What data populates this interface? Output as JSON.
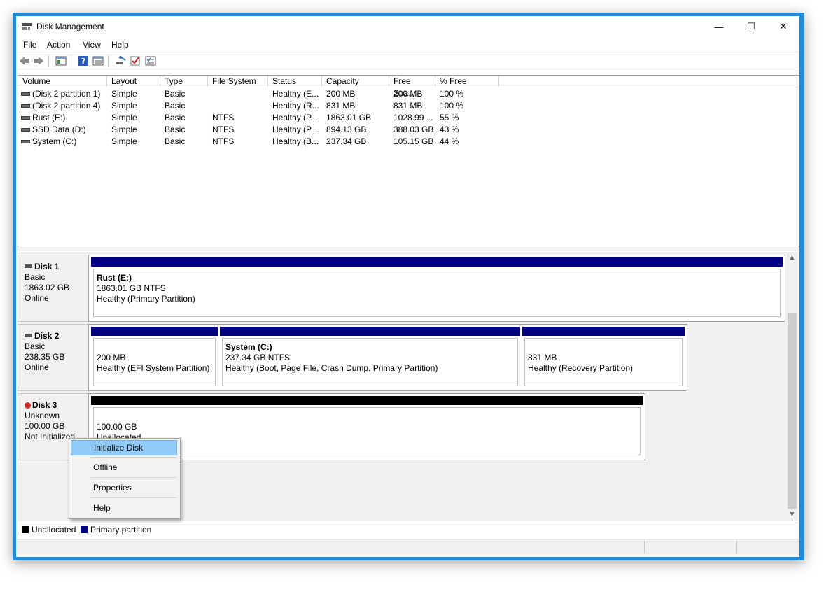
{
  "window": {
    "title": "Disk Management",
    "minimize": "—",
    "maximize": "☐",
    "close": "✕"
  },
  "menu": [
    "File",
    "Action",
    "View",
    "Help"
  ],
  "toolbar": {
    "icons": [
      "back-arrow-icon",
      "forward-arrow-icon",
      "console-tree-icon",
      "help-icon",
      "properties-list-icon",
      "rescan-disks-icon",
      "check-icon",
      "list-settings-icon"
    ]
  },
  "volumes": {
    "columns": [
      "Volume",
      "Layout",
      "Type",
      "File System",
      "Status",
      "Capacity",
      "Free Spa...",
      "% Free"
    ],
    "rows": [
      [
        "(Disk 2 partition 1)",
        "Simple",
        "Basic",
        "",
        "Healthy (E...",
        "200 MB",
        "200 MB",
        "100 %"
      ],
      [
        "(Disk 2 partition 4)",
        "Simple",
        "Basic",
        "",
        "Healthy (R...",
        "831 MB",
        "831 MB",
        "100 %"
      ],
      [
        "Rust (E:)",
        "Simple",
        "Basic",
        "NTFS",
        "Healthy (P...",
        "1863.01 GB",
        "1028.99 ...",
        "55 %"
      ],
      [
        "SSD Data (D:)",
        "Simple",
        "Basic",
        "NTFS",
        "Healthy (P...",
        "894.13 GB",
        "388.03 GB",
        "43 %"
      ],
      [
        "System (C:)",
        "Simple",
        "Basic",
        "NTFS",
        "Healthy (B...",
        "237.34 GB",
        "105.15 GB",
        "44 %"
      ]
    ]
  },
  "disks": {
    "disk1": {
      "name": "Disk 1",
      "type": "Basic",
      "size": "1863.02 GB",
      "state": "Online",
      "parts": [
        {
          "name": "Rust  (E:)",
          "size": "1863.01 GB NTFS",
          "status": "Healthy (Primary Partition)"
        }
      ]
    },
    "disk2": {
      "name": "Disk 2",
      "type": "Basic",
      "size": "238.35 GB",
      "state": "Online",
      "parts": [
        {
          "size": "200 MB",
          "status": "Healthy (EFI System Partition)"
        },
        {
          "name": "System  (C:)",
          "size": "237.34 GB NTFS",
          "status": "Healthy (Boot, Page File, Crash Dump, Primary Partition)"
        },
        {
          "size": "831 MB",
          "status": "Healthy (Recovery Partition)"
        }
      ]
    },
    "disk3": {
      "name": "Disk 3",
      "type": "Unknown",
      "size": "100.00 GB",
      "state": "Not Initialized",
      "parts": [
        {
          "size": "100.00 GB",
          "status": "Unallocated"
        }
      ]
    }
  },
  "legend": {
    "unallocated": "Unallocated",
    "primary": "Primary partition",
    "unallocated_color": "#000000",
    "primary_color": "#000080"
  },
  "context_menu": {
    "items": [
      "Initialize Disk",
      "Offline",
      "Properties",
      "Help"
    ],
    "highlighted": "Initialize Disk"
  },
  "colors": {
    "primary_bar": "#000080",
    "unallocated_bar": "#000000",
    "highlight": "#91c9f7",
    "frame": "#1d8bd8"
  }
}
